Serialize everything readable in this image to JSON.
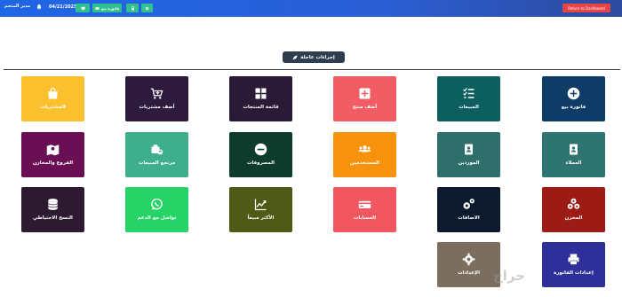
{
  "header": {
    "user_name": "مدير المتجم",
    "date": "04/21/2025",
    "new_sale_label": "فاتورة بيع",
    "logout_label": "Return to Dashboard",
    "accent": "#1f66e5"
  },
  "quick_actions": {
    "label": "إجراءات عاجلة"
  },
  "tiles": [
    {
      "label": "فاتورة بيع",
      "icon": "plus-circle-icon",
      "color": "#0e3c67"
    },
    {
      "label": "المبيعات",
      "icon": "list-check-icon",
      "color": "#0c5f5e"
    },
    {
      "label": "أضف منتج",
      "icon": "add-box-icon",
      "color": "#f25c64"
    },
    {
      "label": "قائمة المنتجات",
      "icon": "grid-icon",
      "color": "#2b1a35"
    },
    {
      "label": "أضف مشتريات",
      "icon": "cart-add-icon",
      "color": "#2e1a3c"
    },
    {
      "label": "المشتريات",
      "icon": "shopping-bag-icon",
      "color": "#fbc02d"
    },
    {
      "label": "العملاء",
      "icon": "contact-book-icon",
      "color": "#2e7470"
    },
    {
      "label": "الموردين",
      "icon": "contact-book-icon",
      "color": "#2e6e6b"
    },
    {
      "label": "المستخدمين",
      "icon": "users-icon",
      "color": "#f7920d"
    },
    {
      "label": "المصروفات",
      "icon": "minus-circle-icon",
      "color": "#0d3b2c"
    },
    {
      "label": "مرتجع المبيعات",
      "icon": "cash-return-icon",
      "color": "#3fae8c"
    },
    {
      "label": "الفروع والمخازن",
      "icon": "map-pin-icon",
      "color": "#6b0f54"
    },
    {
      "label": "المخزن",
      "icon": "boxes-icon",
      "color": "#9c1b14"
    },
    {
      "label": "الاضافات",
      "icon": "gears-icon",
      "color": "#0d1a2e"
    },
    {
      "label": "الحسابات",
      "icon": "money-card-icon",
      "color": "#f2565e"
    },
    {
      "label": "الأكثر مبيعاً",
      "icon": "chart-up-icon",
      "color": "#4e5a16"
    },
    {
      "label": "تواصل مع الدعم",
      "icon": "whatsapp-icon",
      "color": "#25d366"
    },
    {
      "label": "النسخ الاحتياطي",
      "icon": "database-icon",
      "color": "#2d1a30"
    },
    {
      "label": "إعدادات الفاتورة",
      "icon": "printer-icon",
      "color": "#2f2f9a"
    },
    {
      "label": "الإعدادات",
      "icon": "gear-icon",
      "color": "#7b6e5e"
    }
  ],
  "watermark": "حراج"
}
